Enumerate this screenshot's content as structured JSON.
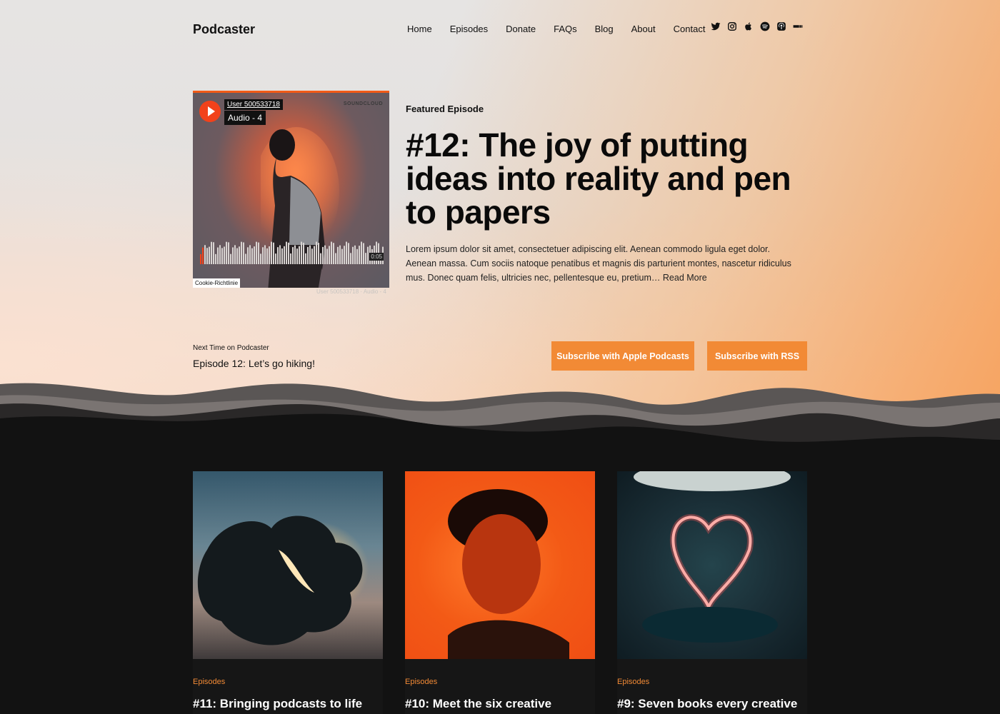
{
  "site": {
    "logo": "Podcaster"
  },
  "nav": [
    {
      "label": "Home"
    },
    {
      "label": "Episodes"
    },
    {
      "label": "Donate"
    },
    {
      "label": "FAQs"
    },
    {
      "label": "Blog"
    },
    {
      "label": "About"
    },
    {
      "label": "Contact"
    }
  ],
  "social": [
    "twitter-icon",
    "instagram-icon",
    "apple-icon",
    "spotify-icon",
    "podcasts-icon",
    "more-icon"
  ],
  "player": {
    "user": "User 500533718",
    "track": "Audio - 4",
    "brand": "SOUNDCLOUD",
    "time": "0:05",
    "cookie": "Cookie-Richtlinie",
    "footer": "User 500533718 · Audio - 4"
  },
  "featured": {
    "label": "Featured Episode",
    "title": "#12: The joy of putting ideas into reality and pen to papers",
    "excerpt": "Lorem ipsum dolor sit amet, consectetuer adipiscing elit. Aenean commodo ligula eget dolor. Aenean massa. Cum sociis natoque penatibus et magnis dis parturient montes, nascetur ridiculus mus. Donec quam felis, ultricies nec, pellentesque eu, pretium…",
    "read_more": "Read More"
  },
  "next": {
    "label": "Next Time on Podcaster",
    "title": "Episode 12: Let’s go hiking!"
  },
  "buttons": {
    "apple": "Subscribe with Apple Podcasts",
    "rss": "Subscribe with RSS"
  },
  "colors": {
    "accent": "#f28a35",
    "soundcloud": "#f2421b",
    "dark": "#121212"
  },
  "cards": [
    {
      "category": "Episodes",
      "title": "#11: Bringing podcasts to life"
    },
    {
      "category": "Episodes",
      "title": "#10: Meet the six creative"
    },
    {
      "category": "Episodes",
      "title": "#9: Seven books every creative"
    }
  ]
}
